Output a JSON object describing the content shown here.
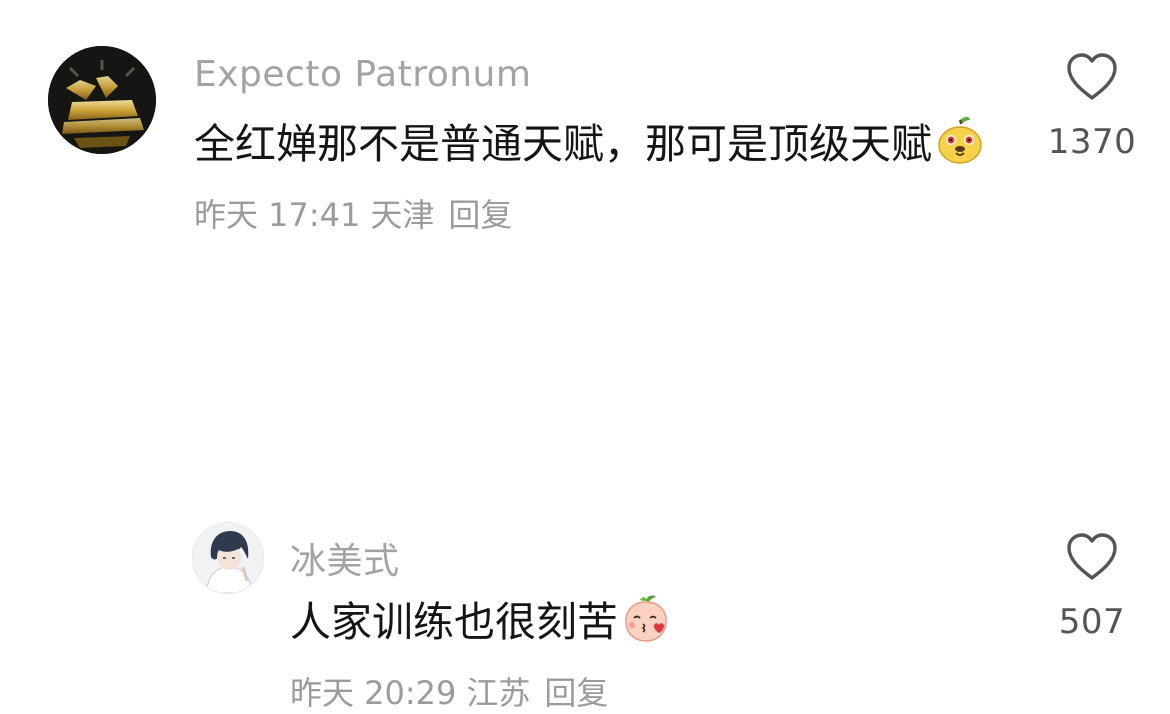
{
  "comments": [
    {
      "username": "Expecto Patronum",
      "avatar_icon": "go-yourself-logo-avatar",
      "text": "全红婵那不是普通天赋，那可是顶级天赋",
      "emoji_icon": "pear-face-emoji",
      "time": "昨天 17:41",
      "location": "天津",
      "reply_label": "回复",
      "like_count": "1370",
      "like_icon": "heart-outline-icon"
    },
    {
      "username": "冰美式",
      "avatar_icon": "anime-character-avatar",
      "text": "人家训练也很刻苦",
      "emoji_icon": "peach-kiss-emoji",
      "time": "昨天 20:29",
      "location": "江苏",
      "reply_label": "回复",
      "like_count": "507",
      "like_icon": "heart-outline-icon"
    }
  ],
  "colors": {
    "username": "#a3a3a3",
    "meta": "#9b9b9b",
    "text": "#151515",
    "like_count": "#555555"
  }
}
